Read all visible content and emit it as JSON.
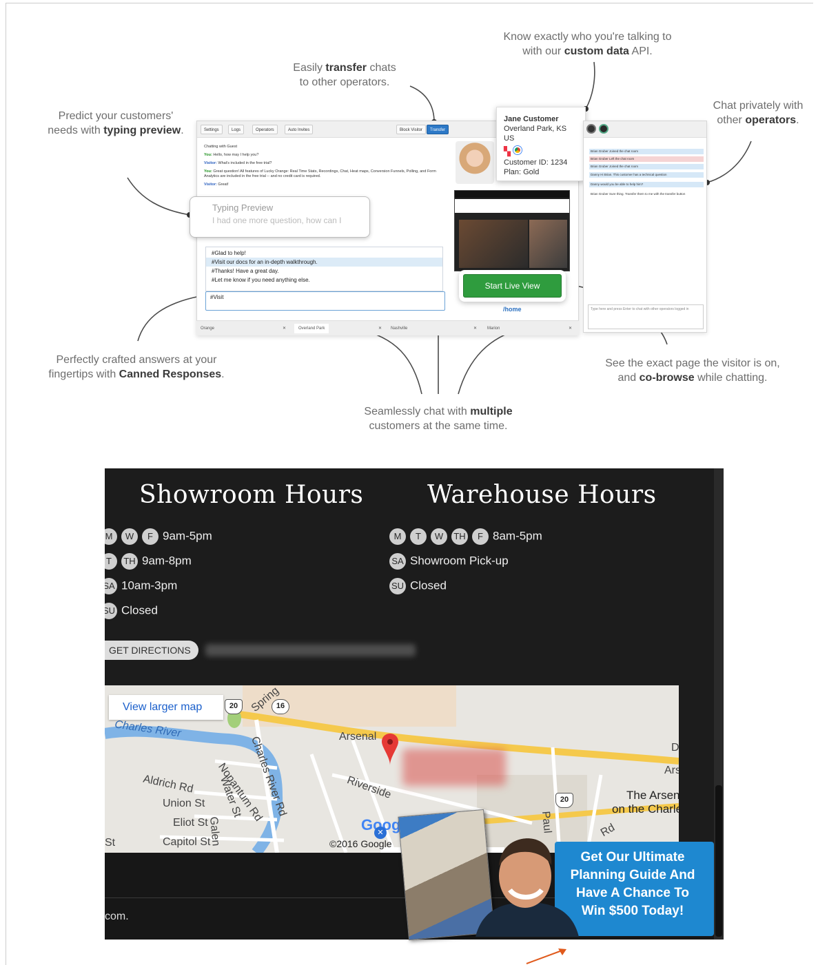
{
  "callouts": {
    "typing_preview": {
      "pre": "Predict your customers'",
      "mid": "needs with ",
      "bold": "typing preview",
      "post": "."
    },
    "transfer": {
      "pre": "Easily ",
      "bold": "transfer",
      "post": " chats",
      "line2": "to other operators."
    },
    "custom_data": {
      "line1": "Know exactly who you're talking to",
      "pre": "with our ",
      "bold": "custom data",
      "post": " API."
    },
    "private": {
      "line1": "Chat privately with",
      "pre": "other ",
      "bold": "operators",
      "post": "."
    },
    "canned": {
      "line1": "Perfectly crafted answers at your",
      "pre": "fingertips with ",
      "bold": "Canned Responses",
      "post": "."
    },
    "multiple": {
      "pre": "Seamlessly chat with ",
      "bold": "multiple",
      "line2": "customers at the same time."
    },
    "cobrowse": {
      "line1": "See the exact page the visitor is on,",
      "pre": "and ",
      "bold": "co-browse",
      "post": " while chatting."
    }
  },
  "app": {
    "toolbar": [
      "Settings",
      "Logs",
      "Operators",
      "Auto Invites"
    ],
    "block_visitor": "Block Visitor",
    "transfer": "Transfer",
    "chat_title": "Chatting with Guest",
    "chat": [
      {
        "who": "You:",
        "cls": "you",
        "text": " Hello, how may I help you?"
      },
      {
        "who": "Visitor:",
        "cls": "vis",
        "text": " What's included in the free trial?"
      },
      {
        "who": "You:",
        "cls": "you",
        "text": " Great question! All features of Lucky Orange: Real Time Stats, Recordings, Chat, Heat maps, Conversion Funnels, Polling, and Form Analytics are included in the free trial -- and no credit card is required."
      },
      {
        "who": "Visitor:",
        "cls": "vis",
        "text": " Great!"
      }
    ],
    "typing_title": "Typing Preview",
    "typing_text": "I had one more question, how can I",
    "canned": [
      "#Glad to help!",
      "#Visit our docs for an in-depth walkthrough.",
      "#Thanks! Have a great day.",
      "#Let me know if you need anything else."
    ],
    "input_value": "#Visit",
    "tabs": [
      "Orange",
      "Overland Park",
      "Nashville",
      "Marion"
    ],
    "customer": {
      "name": "Jane Customer",
      "location": "Overland Park, KS US",
      "id": "Customer ID: 1234",
      "plan": "Plan: Gold"
    },
    "live_view": "Start Live View",
    "page_path": "/home",
    "ops_messages": [
      {
        "text": "Brian Gruber Joined the chat room",
        "cls": "blue"
      },
      {
        "text": "Brian Gruber Left the chat room",
        "cls": "red"
      },
      {
        "text": "Brian Gruber Joined the chat room",
        "cls": "blue"
      },
      {
        "text": "Danny Hi Brian. This customer has a technical question",
        "cls": "blue"
      },
      {
        "text": "Danny would you be able to help him?",
        "cls": "blue"
      },
      {
        "text": "Brian Gruber Sure thing. Transfer them to me with the transfer button",
        "cls": ""
      }
    ],
    "ops_placeholder": "Type here and press Enter to chat with other operators logged in"
  },
  "site": {
    "showroom_title": "Showroom Hours",
    "warehouse_title": "Warehouse Hours",
    "showroom_rows": [
      {
        "days": [
          "M",
          "W",
          "F"
        ],
        "text": "9am-5pm"
      },
      {
        "days": [
          "T",
          "TH"
        ],
        "text": "9am-8pm"
      },
      {
        "days": [
          "SA"
        ],
        "text": "10am-3pm"
      },
      {
        "days": [
          "SU"
        ],
        "text": "Closed"
      }
    ],
    "warehouse_rows": [
      {
        "days": [
          "M",
          "T",
          "W",
          "TH",
          "F"
        ],
        "text": "8am-5pm"
      },
      {
        "days": [
          "SA"
        ],
        "text": "Showroom Pick-up"
      },
      {
        "days": [
          "SU"
        ],
        "text": "Closed"
      }
    ],
    "directions": "GET DIRECTIONS",
    "map": {
      "larger": "View larger map",
      "labels": [
        "Charles River",
        "Arsenal",
        "Aldrich Rd",
        "Union St",
        "Eliot St",
        "Capitol St",
        "Nonantum Rd",
        "Water St",
        "Charles River Rd",
        "Riverside",
        "Galen",
        "Paul",
        "The Arsenal",
        "on the Charles",
        "Ars",
        "D",
        "Spring",
        "Rd",
        "St"
      ],
      "shields": [
        "20",
        "16",
        "20"
      ],
      "copyright": "©2016 Google",
      "google": "Google"
    },
    "footer_text": "com.",
    "promo": "Get Our Ultimate Planning Guide And Have A Chance To Win $500 Today!"
  },
  "colors": {
    "accent_blue": "#1e88d0",
    "live_green": "#2f9c3e",
    "arrow_orange": "#e05a1c"
  }
}
